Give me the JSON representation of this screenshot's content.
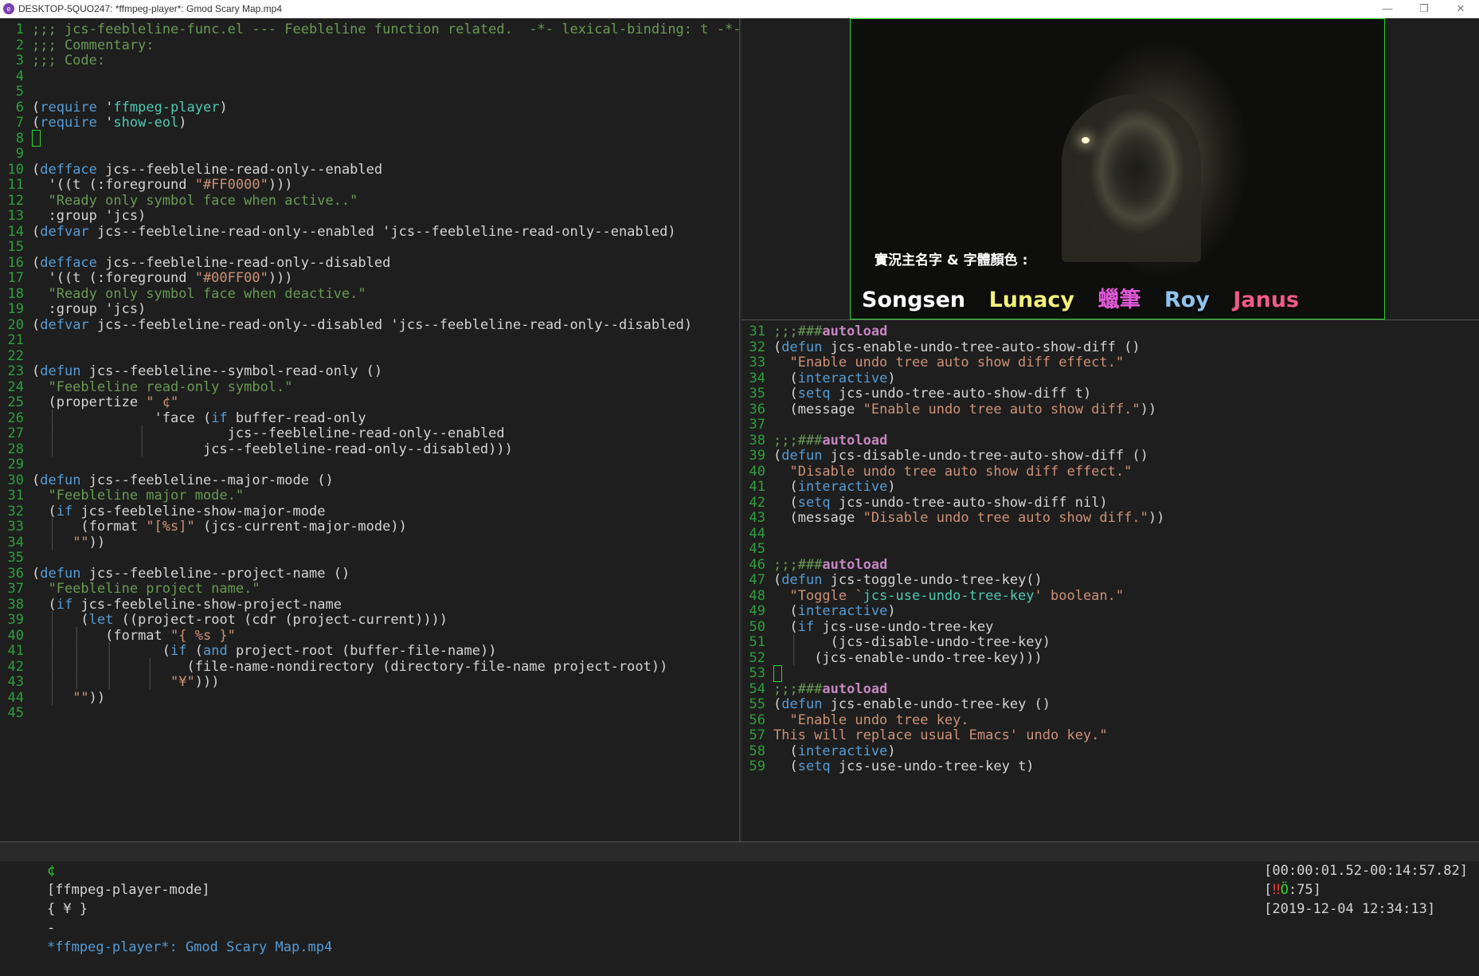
{
  "window": {
    "title": "DESKTOP-5QUO247: *ffmpeg-player*: Gmod Scary Map.mp4",
    "controls": [
      "—",
      "❐",
      "✕"
    ]
  },
  "left_pane": {
    "lines": [
      {
        "n": "1",
        "segs": [
          [
            "c-comment",
            ";;; jcs-feebleline-func.el --- Feebleline function related.  -*- lexical-binding: t -*-"
          ]
        ]
      },
      {
        "n": "2",
        "segs": [
          [
            "c-comment",
            ";;; Commentary:"
          ]
        ]
      },
      {
        "n": "3",
        "segs": [
          [
            "c-comment",
            ";;; Code:"
          ]
        ]
      },
      {
        "n": "4",
        "segs": []
      },
      {
        "n": "5",
        "segs": []
      },
      {
        "n": "6",
        "segs": [
          [
            "",
            "("
          ],
          [
            "c-kw",
            "require"
          ],
          [
            "",
            " '"
          ],
          [
            "c-sym",
            "ffmpeg-player"
          ],
          [
            "",
            ")"
          ]
        ]
      },
      {
        "n": "7",
        "segs": [
          [
            "",
            "("
          ],
          [
            "c-kw",
            "require"
          ],
          [
            "",
            " '"
          ],
          [
            "c-sym",
            "show-eol"
          ],
          [
            "",
            ")"
          ]
        ]
      },
      {
        "n": "8",
        "segs": [
          [
            "cursor",
            ""
          ]
        ]
      },
      {
        "n": "9",
        "segs": []
      },
      {
        "n": "10",
        "segs": [
          [
            "",
            "("
          ],
          [
            "c-kw",
            "defface"
          ],
          [
            "",
            " jcs--feebleline-read-only--enabled"
          ]
        ]
      },
      {
        "n": "11",
        "segs": [
          [
            "",
            "  '((t (:foreground "
          ],
          [
            "c-str",
            "\"#FF0000\""
          ],
          [
            "",
            ")))"
          ]
        ]
      },
      {
        "n": "12",
        "segs": [
          [
            "c-doc",
            "  \"Ready only symbol face when active..\""
          ]
        ]
      },
      {
        "n": "13",
        "segs": [
          [
            "",
            "  :group 'jcs)"
          ]
        ]
      },
      {
        "n": "14",
        "segs": [
          [
            "",
            "("
          ],
          [
            "c-kw",
            "defvar"
          ],
          [
            "",
            " jcs--feebleline-read-only--enabled 'jcs--feebleline-read-only--enabled)"
          ]
        ]
      },
      {
        "n": "15",
        "segs": []
      },
      {
        "n": "16",
        "segs": [
          [
            "",
            "("
          ],
          [
            "c-kw",
            "defface"
          ],
          [
            "",
            " jcs--feebleline-read-only--disabled"
          ]
        ]
      },
      {
        "n": "17",
        "segs": [
          [
            "",
            "  '((t (:foreground "
          ],
          [
            "c-str",
            "\"#00FF00\""
          ],
          [
            "",
            ")))"
          ]
        ]
      },
      {
        "n": "18",
        "segs": [
          [
            "c-doc",
            "  \"Ready only symbol face when deactive.\""
          ]
        ]
      },
      {
        "n": "19",
        "segs": [
          [
            "",
            "  :group 'jcs)"
          ]
        ]
      },
      {
        "n": "20",
        "segs": [
          [
            "",
            "("
          ],
          [
            "c-kw",
            "defvar"
          ],
          [
            "",
            " jcs--feebleline-read-only--disabled 'jcs--feebleline-read-only--disabled)"
          ]
        ]
      },
      {
        "n": "21",
        "segs": []
      },
      {
        "n": "22",
        "segs": []
      },
      {
        "n": "23",
        "segs": [
          [
            "",
            "("
          ],
          [
            "c-kw",
            "defun"
          ],
          [
            "",
            " jcs--feebleline--symbol-read-only ()"
          ]
        ]
      },
      {
        "n": "24",
        "segs": [
          [
            "c-doc",
            "  \"Feebleline read-only symbol.\""
          ]
        ]
      },
      {
        "n": "25",
        "segs": [
          [
            "",
            "  (propertize "
          ],
          [
            "c-str",
            "\" ¢\""
          ]
        ]
      },
      {
        "n": "26",
        "segs": [
          [
            "guide",
            "  │          "
          ],
          [
            "",
            "  'face ("
          ],
          [
            "c-kw",
            "if"
          ],
          [
            "",
            " buffer-read-only"
          ]
        ]
      },
      {
        "n": "27",
        "segs": [
          [
            "guide",
            "  │          │        "
          ],
          [
            "",
            "  jcs--feebleline-read-only--enabled"
          ]
        ]
      },
      {
        "n": "28",
        "segs": [
          [
            "guide",
            "  │          │     "
          ],
          [
            "",
            "  jcs--feebleline-read-only--disabled)))"
          ]
        ]
      },
      {
        "n": "29",
        "segs": []
      },
      {
        "n": "30",
        "segs": [
          [
            "",
            "("
          ],
          [
            "c-kw",
            "defun"
          ],
          [
            "",
            " jcs--feebleline--major-mode ()"
          ]
        ]
      },
      {
        "n": "31",
        "segs": [
          [
            "c-doc",
            "  \"Feebleline major mode.\""
          ]
        ]
      },
      {
        "n": "32",
        "segs": [
          [
            "",
            "  ("
          ],
          [
            "c-kw",
            "if"
          ],
          [
            "",
            " jcs-feebleline-show-major-mode"
          ]
        ]
      },
      {
        "n": "33",
        "segs": [
          [
            "guide",
            "  │ "
          ],
          [
            "",
            "  (format "
          ],
          [
            "c-str",
            "\"[%s]\""
          ],
          [
            "",
            " (jcs-current-major-mode))"
          ]
        ]
      },
      {
        "n": "34",
        "segs": [
          [
            "guide",
            "  │ "
          ],
          [
            "c-str",
            " \"\""
          ],
          [
            "",
            "))"
          ]
        ]
      },
      {
        "n": "35",
        "segs": []
      },
      {
        "n": "36",
        "segs": [
          [
            "",
            "("
          ],
          [
            "c-kw",
            "defun"
          ],
          [
            "",
            " jcs--feebleline--project-name ()"
          ]
        ]
      },
      {
        "n": "37",
        "segs": [
          [
            "c-doc",
            "  \"Feebleline project name.\""
          ]
        ]
      },
      {
        "n": "38",
        "segs": [
          [
            "",
            "  ("
          ],
          [
            "c-kw",
            "if"
          ],
          [
            "",
            " jcs-feebleline-show-project-name"
          ]
        ]
      },
      {
        "n": "39",
        "segs": [
          [
            "guide",
            "  │ "
          ],
          [
            "",
            "  ("
          ],
          [
            "c-kw",
            "let"
          ],
          [
            "",
            " ((project-root (cdr (project-current))))"
          ]
        ]
      },
      {
        "n": "40",
        "segs": [
          [
            "guide",
            "  │  │ "
          ],
          [
            "",
            "  (format "
          ],
          [
            "c-str",
            "\"{ %s }\""
          ]
        ]
      },
      {
        "n": "41",
        "segs": [
          [
            "guide",
            "  │  │   │    "
          ],
          [
            "",
            "  ("
          ],
          [
            "c-kw",
            "if"
          ],
          [
            "",
            " ("
          ],
          [
            "c-kw",
            "and"
          ],
          [
            "",
            " project-root (buffer-file-name))"
          ]
        ]
      },
      {
        "n": "42",
        "segs": [
          [
            "guide",
            "  │  │   │    │ "
          ],
          [
            "",
            "   (file-name-nondirectory (directory-file-name project-root))"
          ]
        ]
      },
      {
        "n": "43",
        "segs": [
          [
            "guide",
            "  │  │   │    │"
          ],
          [
            "c-str",
            "  \"¥\""
          ],
          [
            "",
            ")))"
          ]
        ]
      },
      {
        "n": "44",
        "segs": [
          [
            "guide",
            "  │ "
          ],
          [
            "c-str",
            " \"\""
          ],
          [
            "",
            "))"
          ]
        ]
      },
      {
        "n": "45",
        "segs": []
      }
    ]
  },
  "video": {
    "caption_label": "實況主名字 & 字體顏色 :",
    "names": [
      {
        "text": "Songsen",
        "color": "#ffffff"
      },
      {
        "text": "Lunacy",
        "color": "#f2f27a"
      },
      {
        "text": "蠟筆",
        "color": "#e05ad8"
      },
      {
        "text": "Roy",
        "color": "#8fc3ee"
      },
      {
        "text": "Janus",
        "color": "#ef5b8a"
      }
    ]
  },
  "right_pane": {
    "lines": [
      {
        "n": "31",
        "segs": [
          [
            "c-comment",
            ";;;###"
          ],
          [
            "c-auto",
            "autoload"
          ]
        ]
      },
      {
        "n": "32",
        "segs": [
          [
            "",
            "("
          ],
          [
            "c-kw",
            "defun"
          ],
          [
            "",
            " jcs-enable-undo-tree-auto-show-diff ()"
          ]
        ]
      },
      {
        "n": "33",
        "segs": [
          [
            "c-str",
            "  \"Enable undo tree auto show diff effect.\""
          ]
        ]
      },
      {
        "n": "34",
        "segs": [
          [
            "",
            "  ("
          ],
          [
            "c-kw",
            "interactive"
          ],
          [
            "",
            ")"
          ]
        ]
      },
      {
        "n": "35",
        "segs": [
          [
            "",
            "  ("
          ],
          [
            "c-kw",
            "setq"
          ],
          [
            "",
            " jcs-undo-tree-auto-show-diff t)"
          ]
        ]
      },
      {
        "n": "36",
        "segs": [
          [
            "",
            "  (message "
          ],
          [
            "c-str",
            "\"Enable undo tree auto show diff.\""
          ],
          [
            "",
            "))"
          ]
        ]
      },
      {
        "n": "37",
        "segs": []
      },
      {
        "n": "38",
        "segs": [
          [
            "c-comment",
            ";;;###"
          ],
          [
            "c-auto",
            "autoload"
          ]
        ]
      },
      {
        "n": "39",
        "segs": [
          [
            "",
            "("
          ],
          [
            "c-kw",
            "defun"
          ],
          [
            "",
            " jcs-disable-undo-tree-auto-show-diff ()"
          ]
        ]
      },
      {
        "n": "40",
        "segs": [
          [
            "c-str",
            "  \"Disable undo tree auto show diff effect.\""
          ]
        ]
      },
      {
        "n": "41",
        "segs": [
          [
            "",
            "  ("
          ],
          [
            "c-kw",
            "interactive"
          ],
          [
            "",
            ")"
          ]
        ]
      },
      {
        "n": "42",
        "segs": [
          [
            "",
            "  ("
          ],
          [
            "c-kw",
            "setq"
          ],
          [
            "",
            " jcs-undo-tree-auto-show-diff nil)"
          ]
        ]
      },
      {
        "n": "43",
        "segs": [
          [
            "",
            "  (message "
          ],
          [
            "c-str",
            "\"Disable undo tree auto show diff.\""
          ],
          [
            "",
            "))"
          ]
        ]
      },
      {
        "n": "44",
        "segs": []
      },
      {
        "n": "45",
        "segs": []
      },
      {
        "n": "46",
        "segs": [
          [
            "c-comment",
            ";;;###"
          ],
          [
            "c-auto",
            "autoload"
          ]
        ]
      },
      {
        "n": "47",
        "segs": [
          [
            "",
            "("
          ],
          [
            "c-kw",
            "defun"
          ],
          [
            "",
            " jcs-toggle-undo-tree-key()"
          ]
        ]
      },
      {
        "n": "48",
        "segs": [
          [
            "c-str",
            "  \"Toggle `"
          ],
          [
            "c-sym",
            "jcs-use-undo-tree-key"
          ],
          [
            "c-str",
            "' boolean.\""
          ]
        ]
      },
      {
        "n": "49",
        "segs": [
          [
            "",
            "  ("
          ],
          [
            "c-kw",
            "interactive"
          ],
          [
            "",
            ")"
          ]
        ]
      },
      {
        "n": "50",
        "segs": [
          [
            "",
            "  ("
          ],
          [
            "c-kw",
            "if"
          ],
          [
            "",
            " jcs-use-undo-tree-key"
          ]
        ]
      },
      {
        "n": "51",
        "segs": [
          [
            "guide",
            "  │ "
          ],
          [
            "",
            "   (jcs-disable-undo-tree-key)"
          ]
        ]
      },
      {
        "n": "52",
        "segs": [
          [
            "guide",
            "  │"
          ],
          [
            "",
            "  (jcs-enable-undo-tree-key)))"
          ]
        ]
      },
      {
        "n": "53",
        "segs": [
          [
            "cursor",
            ""
          ]
        ]
      },
      {
        "n": "54",
        "segs": [
          [
            "c-comment",
            ";;;###"
          ],
          [
            "c-auto",
            "autoload"
          ]
        ]
      },
      {
        "n": "55",
        "segs": [
          [
            "",
            "("
          ],
          [
            "c-kw",
            "defun"
          ],
          [
            "",
            " jcs-enable-undo-tree-key ()"
          ]
        ]
      },
      {
        "n": "56",
        "segs": [
          [
            "c-str",
            "  \"Enable undo tree key."
          ]
        ]
      },
      {
        "n": "57",
        "segs": [
          [
            "c-str",
            "This will replace usual Emacs' undo key.\""
          ]
        ]
      },
      {
        "n": "58",
        "segs": [
          [
            "",
            "  ("
          ],
          [
            "c-kw",
            "interactive"
          ],
          [
            "",
            ")"
          ]
        ]
      },
      {
        "n": "59",
        "segs": [
          [
            "",
            "  ("
          ],
          [
            "c-kw",
            "setq"
          ],
          [
            "",
            " jcs-use-undo-tree-key t)"
          ]
        ]
      }
    ]
  },
  "modeline": {
    "read_only_symbol": "¢",
    "mode": "[ffmpeg-player-mode]",
    "project": "{ ¥ }",
    "separator": "-",
    "buffer_name": "*ffmpeg-player*: Gmod Scary Map.mp4",
    "time_range": "[00:00:01.52-00:14:57.82]",
    "volume_open": "[",
    "volume_bars": "‼",
    "volume_icon": "Ö",
    "volume_value": ":75]",
    "datetime": "[2019-12-04 12:34:13]"
  },
  "colors": {
    "line_number": "#2e9f3e",
    "keyword": "#569cd6",
    "string": "#ce9178",
    "comment": "#6a9955",
    "symbol": "#4ec9b0",
    "cursor_border": "#2bd62b"
  }
}
